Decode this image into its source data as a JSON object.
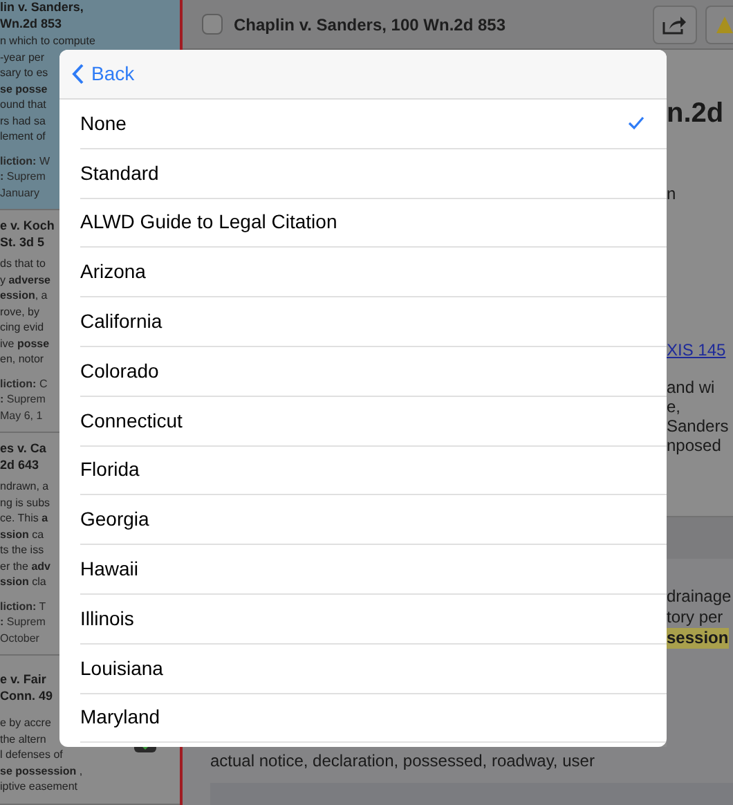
{
  "document_bar": {
    "checked": false,
    "title": "Chaplin v. Sanders, 100 Wn.2d 853"
  },
  "result_cards": [
    {
      "selected": true,
      "title_lines": [
        "lin v. Sanders,",
        "Wn.2d 853"
      ],
      "body_lines": [
        "n which to compute",
        "-year per",
        "sary to es",
        "**se posse**",
        "ound that",
        "rs had sa",
        "lement of"
      ],
      "meta_lines": [
        "**liction:** W",
        "**:** Suprem",
        "January"
      ]
    },
    {
      "selected": false,
      "title_lines": [
        "e v. Koch",
        "St. 3d 5"
      ],
      "body_lines": [
        "ds that to",
        "y **adverse**",
        "**ession**, a",
        "rove, by",
        "cing evid",
        "ive **posse**",
        "en, notor"
      ],
      "meta_lines": [
        "**liction:** C",
        "**:** Suprem",
        "May 6, 1"
      ]
    },
    {
      "selected": false,
      "title_lines": [
        "es v. Ca",
        "2d 643"
      ],
      "body_lines": [
        "ndrawn, a",
        "ng is subs",
        "ce. This **a**",
        "**ssion** ca",
        "ts the iss",
        "er the **adv**",
        "**ssion** cla"
      ],
      "meta_lines": [
        "**liction:** T",
        "**:** Suprem",
        "October"
      ]
    },
    {
      "selected": false,
      "title_lines": [
        "e v. Fair",
        "Conn. 49"
      ],
      "body_lines": [
        "e by accre",
        "the altern",
        "l defenses of",
        "**se possession** ,",
        "iptive easement"
      ]
    }
  ],
  "document": {
    "heading": "n.2d",
    "line": "n",
    "link": "XIS 145",
    "paragraph_lines": [
      "and wi",
      "e,",
      "Sanders",
      "nposed"
    ],
    "panel_lines": [
      "drainage",
      "tory per"
    ],
    "highlight": "session",
    "keywords": "actual notice, declaration, possessed, roadway, user"
  },
  "popover": {
    "back": "Back",
    "options": [
      {
        "label": "None",
        "selected": true
      },
      {
        "label": "Standard",
        "selected": false
      },
      {
        "label": "ALWD Guide to Legal Citation",
        "selected": false
      },
      {
        "label": "Arizona",
        "selected": false
      },
      {
        "label": "California",
        "selected": false
      },
      {
        "label": "Colorado",
        "selected": false
      },
      {
        "label": "Connecticut",
        "selected": false
      },
      {
        "label": "Florida",
        "selected": false
      },
      {
        "label": "Georgia",
        "selected": false
      },
      {
        "label": "Hawaii",
        "selected": false
      },
      {
        "label": "Illinois",
        "selected": false
      },
      {
        "label": "Louisiana",
        "selected": false
      },
      {
        "label": "Maryland",
        "selected": false
      }
    ]
  }
}
